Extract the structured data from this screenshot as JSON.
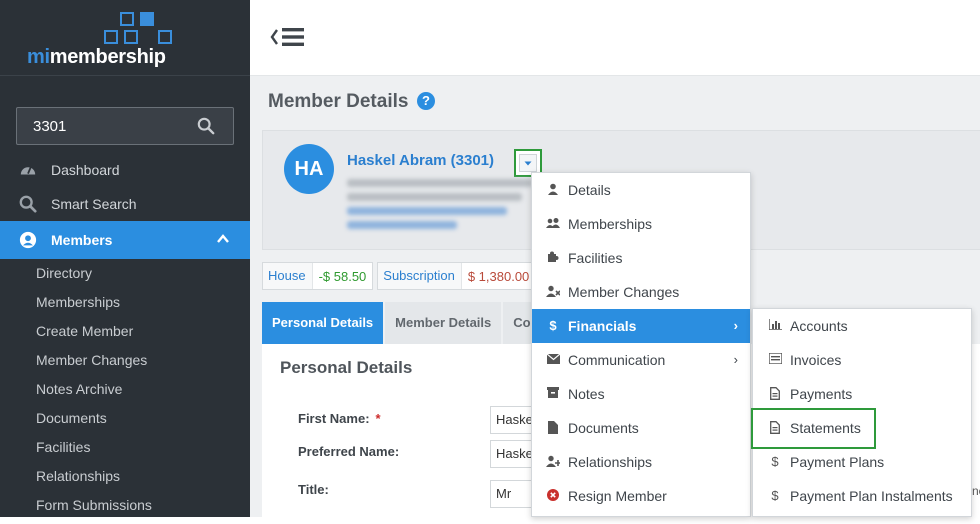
{
  "brand": {
    "prefix": "mi",
    "suffix": "membership",
    "accent": "#2b8ee0"
  },
  "search": {
    "value": "3301",
    "icon": "search-icon"
  },
  "sidebar": {
    "items": [
      {
        "label": "Dashboard",
        "icon": "dashboard-icon"
      },
      {
        "label": "Smart Search",
        "icon": "search-icon"
      },
      {
        "label": "Members",
        "icon": "user-circle-icon",
        "active": true
      }
    ],
    "members_sub": [
      "Directory",
      "Memberships",
      "Create Member",
      "Member Changes",
      "Notes Archive",
      "Documents",
      "Facilities",
      "Relationships",
      "Form Submissions"
    ]
  },
  "page": {
    "title": "Member Details",
    "help": "?"
  },
  "member": {
    "initials": "HA",
    "name": "Haskel Abram (3301)"
  },
  "balances": [
    {
      "label": "House",
      "value": "-$ 58.50",
      "status": "green"
    },
    {
      "label": "Subscription",
      "value": "$ 1,380.00",
      "status": "red"
    }
  ],
  "tabs": [
    "Personal Details",
    "Member Details",
    "Co"
  ],
  "personal": {
    "title": "Personal Details",
    "fields": [
      {
        "label": "First Name:",
        "required": "*",
        "value": "Haske"
      },
      {
        "label": "Preferred Name:",
        "value": "Haske"
      },
      {
        "label": "Title:",
        "value": "Mr"
      }
    ]
  },
  "menu": {
    "items": [
      {
        "label": "Details",
        "icon": "user-icon"
      },
      {
        "label": "Memberships",
        "icon": "users-icon"
      },
      {
        "label": "Facilities",
        "icon": "puzzle-icon"
      },
      {
        "label": "Member Changes",
        "icon": "user-times-icon"
      },
      {
        "label": "Financials",
        "icon": "dollar-icon",
        "active": true,
        "arrow": "›"
      },
      {
        "label": "Communication",
        "icon": "envelope-icon",
        "arrow": "›"
      },
      {
        "label": "Notes",
        "icon": "notes-icon"
      },
      {
        "label": "Documents",
        "icon": "file-icon"
      },
      {
        "label": "Relationships",
        "icon": "user-plus-icon"
      },
      {
        "label": "Resign Member",
        "icon": "times-circle-icon"
      }
    ]
  },
  "submenu": {
    "items": [
      {
        "label": "Accounts",
        "icon": "bar-chart-icon"
      },
      {
        "label": "Invoices",
        "icon": "list-icon"
      },
      {
        "label": "Payments",
        "icon": "file-text-icon"
      },
      {
        "label": "Statements",
        "icon": "file-text-icon"
      },
      {
        "label": "Payment Plans",
        "icon": "dollar-icon"
      },
      {
        "label": "Payment Plan Instalments",
        "icon": "dollar-icon"
      }
    ]
  },
  "overflow": {
    "text": "ne"
  }
}
